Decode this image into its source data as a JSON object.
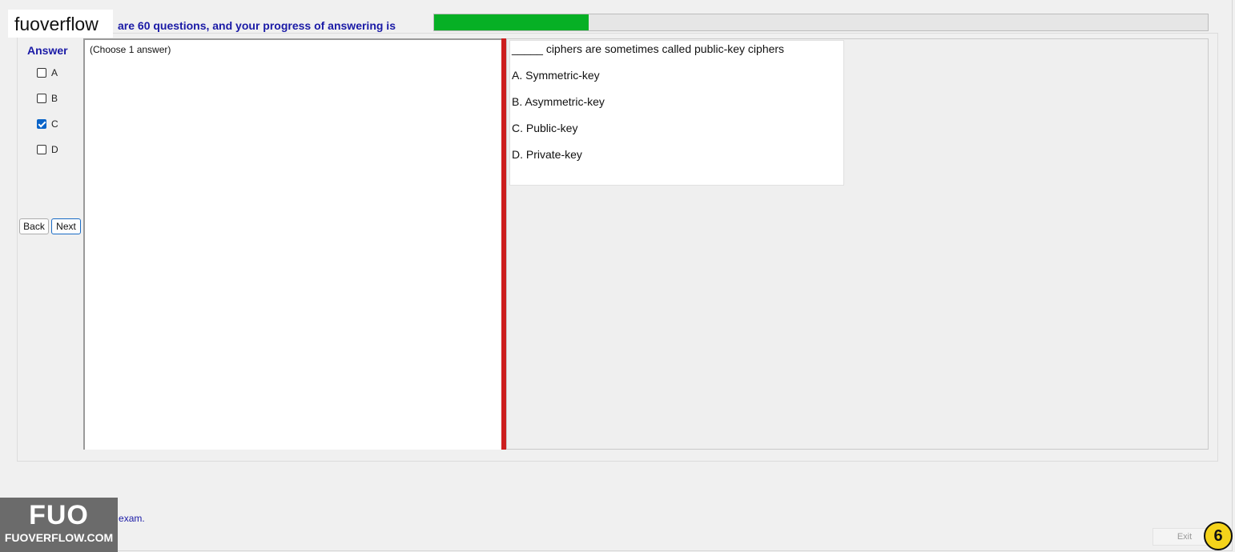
{
  "brand": "fuoverflow",
  "progress": {
    "text": "are 60 questions, and your progress of answering is",
    "fraction": 0.2
  },
  "answer": {
    "title": "Answer",
    "options": [
      {
        "label": "A",
        "checked": false
      },
      {
        "label": "B",
        "checked": false
      },
      {
        "label": "C",
        "checked": true
      },
      {
        "label": "D",
        "checked": false
      }
    ]
  },
  "nav": {
    "back": "Back",
    "next": "Next"
  },
  "left_panel": {
    "instruction": "(Choose 1 answer)"
  },
  "question": {
    "text": "_____ ciphers are sometimes called public-key ciphers",
    "options": [
      "A.  Symmetric-key",
      "B.  Asymmetric-key",
      "C.  Public-key",
      "D.  Private-key"
    ]
  },
  "finish": {
    "label": "I want to finish the exam.",
    "checked": false
  },
  "logo": {
    "big": "FUO",
    "small": "FUOVERFLOW.COM"
  },
  "exit": "Exit",
  "page_number": "6",
  "colors": {
    "progress_fill": "#06b025",
    "divider": "#cc1e1e",
    "accent_text": "#1a1aa6",
    "badge": "#f5d31a"
  }
}
